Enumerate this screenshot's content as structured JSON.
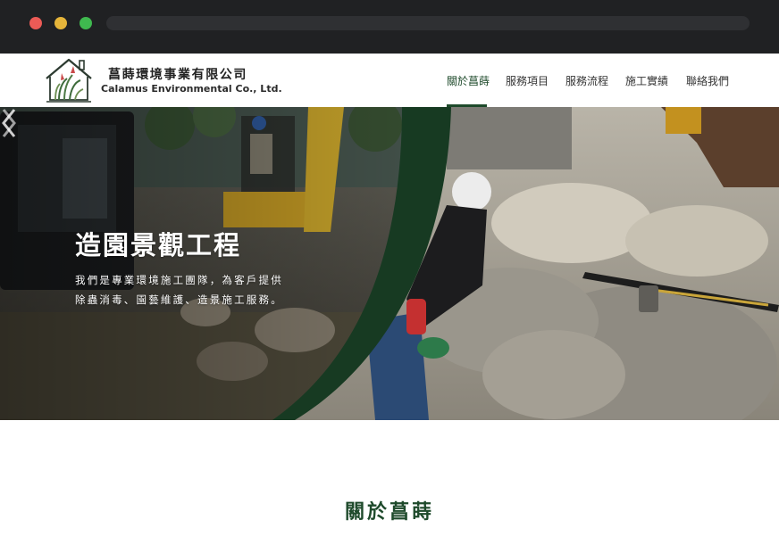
{
  "browser": {
    "controls": [
      "close",
      "minimize",
      "maximize"
    ]
  },
  "brand": {
    "name_zh": "菖蒔環境事業有限公司",
    "name_en": "Calamus Environmental Co., Ltd.",
    "logo_icon": "house-plant-logo-icon"
  },
  "nav": {
    "items": [
      {
        "label": "關於菖蒔",
        "active": true
      },
      {
        "label": "服務項目",
        "active": false
      },
      {
        "label": "服務流程",
        "active": false
      },
      {
        "label": "施工實績",
        "active": false
      },
      {
        "label": "聯絡我們",
        "active": false
      }
    ]
  },
  "hero": {
    "title": "造園景觀工程",
    "desc_line1": "我們是專業環境施工團隊，為客戶提供",
    "desc_line2": "除蟲消毒、園藝維護、造景施工服務。",
    "prev_icon": "chevron-left-icon",
    "next_icon": "chevron-right-icon"
  },
  "about": {
    "title": "關於菖蒔"
  },
  "colors": {
    "brand_green": "#1e4a2b",
    "chrome_bg": "#202123",
    "red_dot": "#ec5b56",
    "yellow_dot": "#e6b53a",
    "green_dot": "#3fb94f"
  }
}
